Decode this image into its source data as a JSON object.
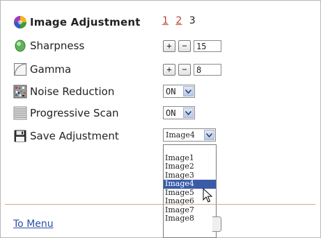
{
  "header": {
    "title": "Image Adjustment",
    "pages": [
      "1",
      "2"
    ],
    "current_page": "3"
  },
  "rows": {
    "sharpness": {
      "label": "Sharpness",
      "plus": "+",
      "minus": "−",
      "value": "15"
    },
    "gamma": {
      "label": "Gamma",
      "plus": "+",
      "minus": "−",
      "value": "8"
    },
    "noise_reduction": {
      "label": "Noise Reduction",
      "value": "ON"
    },
    "progressive_scan": {
      "label": "Progressive Scan",
      "value": "ON"
    },
    "save_adjustment": {
      "label": "Save Adjustment",
      "value": "Image4"
    }
  },
  "dropdown": {
    "options": [
      "Image1",
      "Image2",
      "Image3",
      "Image4",
      "Image5",
      "Image6",
      "Image7",
      "Image8"
    ],
    "highlighted": "Image4"
  },
  "footer": {
    "menu_link": "To Menu"
  },
  "colors": {
    "link": "#2b4fa8",
    "page_link": "#b8452b",
    "highlight": "#3a5ca8",
    "divider": "#c9a896"
  }
}
